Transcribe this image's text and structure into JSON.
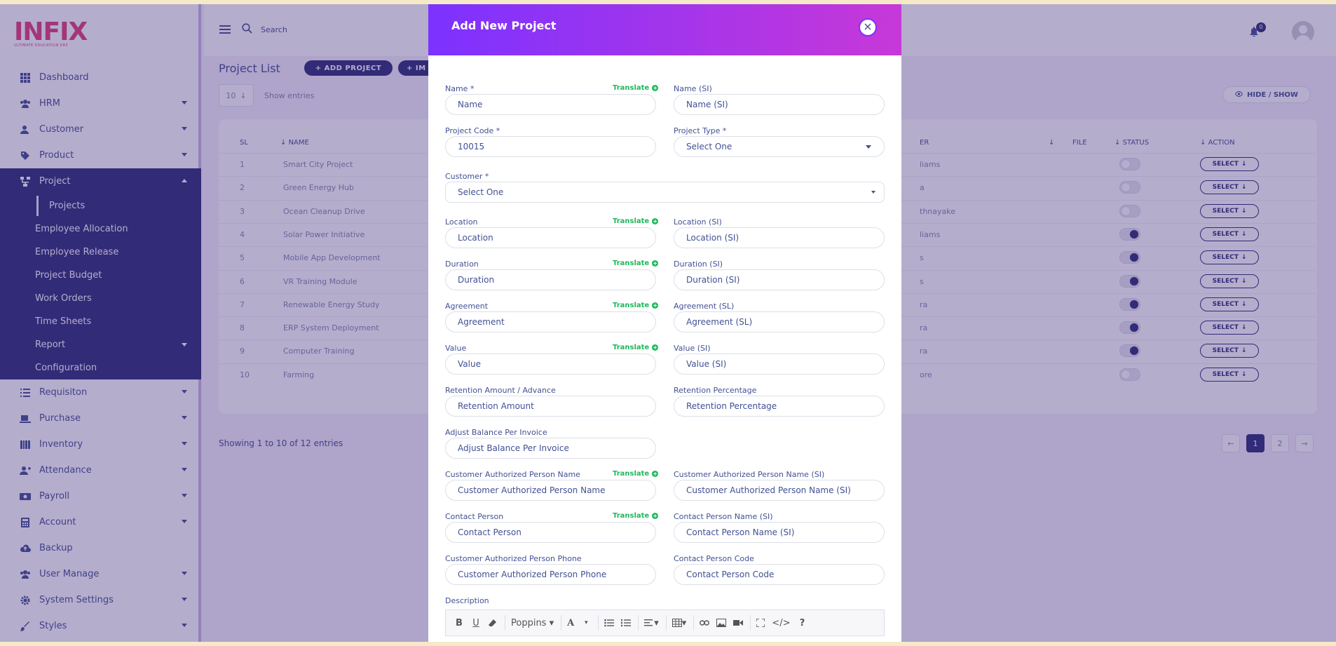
{
  "app": {
    "logo_text": "INFIX",
    "logo_sub": "ULTIMATE EDUCATION ERP"
  },
  "sidebar": {
    "items_top": [
      {
        "label": "Dashboard",
        "icon": "dashboard-icon",
        "caret": false
      },
      {
        "label": "HRM",
        "icon": "hrm-icon",
        "caret": true
      },
      {
        "label": "Customer",
        "icon": "customer-icon",
        "caret": true
      },
      {
        "label": "Product",
        "icon": "product-icon",
        "caret": true
      }
    ],
    "project": {
      "label": "Project",
      "icon": "project-icon"
    },
    "project_sub": [
      {
        "label": "Projects",
        "active": true
      },
      {
        "label": "Employee Allocation"
      },
      {
        "label": "Employee Release"
      },
      {
        "label": "Project Budget"
      },
      {
        "label": "Work Orders"
      },
      {
        "label": "Time Sheets"
      },
      {
        "label": "Report",
        "caret": true
      },
      {
        "label": "Configuration"
      }
    ],
    "items_bottom": [
      {
        "label": "Requisiton",
        "icon": "list-icon"
      },
      {
        "label": "Purchase",
        "icon": "purchase-icon"
      },
      {
        "label": "Inventory",
        "icon": "inventory-icon"
      },
      {
        "label": "Attendance",
        "icon": "attendance-icon"
      },
      {
        "label": "Payroll",
        "icon": "payroll-icon"
      },
      {
        "label": "Account",
        "icon": "account-icon"
      },
      {
        "label": "Backup",
        "icon": "backup-icon"
      },
      {
        "label": "User Manage",
        "icon": "users-icon"
      },
      {
        "label": "System Settings",
        "icon": "gear-icon"
      },
      {
        "label": "Styles",
        "icon": "brush-icon"
      }
    ]
  },
  "topbar": {
    "search_placeholder": "Search",
    "notification_count": "0"
  },
  "page": {
    "title": "Project List",
    "add_project_label": "+ ADD PROJECT",
    "import_label": "+ IM",
    "entries_value": "10",
    "entries_label": "Show entries",
    "hide_show_label": "HIDE / SHOW",
    "showing_text": "Showing 1 to 10 of 12 entries",
    "pages": [
      "1",
      "2"
    ]
  },
  "table": {
    "headers": {
      "sl": "SL",
      "name": "NAME",
      "owner": "ER",
      "file": "FILE",
      "status": "STATUS",
      "action": "ACTION"
    },
    "select_label": "SELECT",
    "rows": [
      {
        "sl": "1",
        "name": "Smart City Project",
        "owner": "liams",
        "status": false
      },
      {
        "sl": "2",
        "name": "Green Energy Hub",
        "owner": "a",
        "status": false
      },
      {
        "sl": "3",
        "name": "Ocean Cleanup Drive",
        "owner": "thnayake",
        "status": false
      },
      {
        "sl": "4",
        "name": "Solar Power Initiative",
        "owner": "liams",
        "status": true
      },
      {
        "sl": "5",
        "name": "Mobile App Development",
        "owner": "s",
        "status": true
      },
      {
        "sl": "6",
        "name": "VR Training Module",
        "owner": "s",
        "status": true
      },
      {
        "sl": "7",
        "name": "Renewable Energy Study",
        "owner": "ra",
        "status": true
      },
      {
        "sl": "8",
        "name": "ERP System Deployment",
        "owner": "ra",
        "status": true
      },
      {
        "sl": "9",
        "name": "Computer Training",
        "owner": "ra",
        "status": true
      },
      {
        "sl": "10",
        "name": "Farming",
        "owner": "ore",
        "status": false
      }
    ]
  },
  "modal": {
    "title": "Add New Project",
    "translate_label": "Translate",
    "fields": {
      "name": {
        "label": "Name *",
        "placeholder": "Name"
      },
      "name_si": {
        "label": "Name (SI)",
        "placeholder": "Name (SI)"
      },
      "project_code": {
        "label": "Project Code *",
        "value": "10015"
      },
      "project_type": {
        "label": "Project Type *",
        "value": "Select One"
      },
      "customer": {
        "label": "Customer *",
        "value": "Select One"
      },
      "location": {
        "label": "Location",
        "placeholder": "Location"
      },
      "location_si": {
        "label": "Location (SI)",
        "placeholder": "Location (SI)"
      },
      "duration": {
        "label": "Duration",
        "placeholder": "Duration"
      },
      "duration_si": {
        "label": "Duration (SI)",
        "placeholder": "Duration (SI)"
      },
      "agreement": {
        "label": "Agreement",
        "placeholder": "Agreement"
      },
      "agreement_sl": {
        "label": "Agreement (SL)",
        "placeholder": "Agreement (SL)"
      },
      "value": {
        "label": "Value",
        "placeholder": "Value"
      },
      "value_si": {
        "label": "Value (SI)",
        "placeholder": "Value (SI)"
      },
      "retention_amount": {
        "label": "Retention Amount / Advance",
        "placeholder": "Retention Amount"
      },
      "retention_percentage": {
        "label": "Retention Percentage",
        "placeholder": "Retention Percentage"
      },
      "adjust_balance": {
        "label": "Adjust Balance Per Invoice",
        "placeholder": "Adjust Balance Per Invoice"
      },
      "cust_auth_name": {
        "label": "Customer Authorized Person Name",
        "placeholder": "Customer Authorized Person Name"
      },
      "cust_auth_name_si": {
        "label": "Customer Authorized Person Name (SI)",
        "placeholder": "Customer Authorized Person Name (SI)"
      },
      "contact_person": {
        "label": "Contact Person",
        "placeholder": "Contact Person"
      },
      "contact_person_si": {
        "label": "Contact Person Name (SI)",
        "placeholder": "Contact Person Name (SI)"
      },
      "cust_auth_phone": {
        "label": "Customer Authorized Person Phone",
        "placeholder": "Customer Authorized Person Phone"
      },
      "contact_person_code": {
        "label": "Contact Person Code",
        "placeholder": "Contact Person Code"
      },
      "description": {
        "label": "Description"
      }
    },
    "editor": {
      "font_name": "Poppins"
    }
  },
  "colors": {
    "primary": "#2a2e78",
    "accent_start": "#7c32ff",
    "accent_end": "#c738d8",
    "translate_green": "#1fb85a",
    "text": "#415094"
  }
}
